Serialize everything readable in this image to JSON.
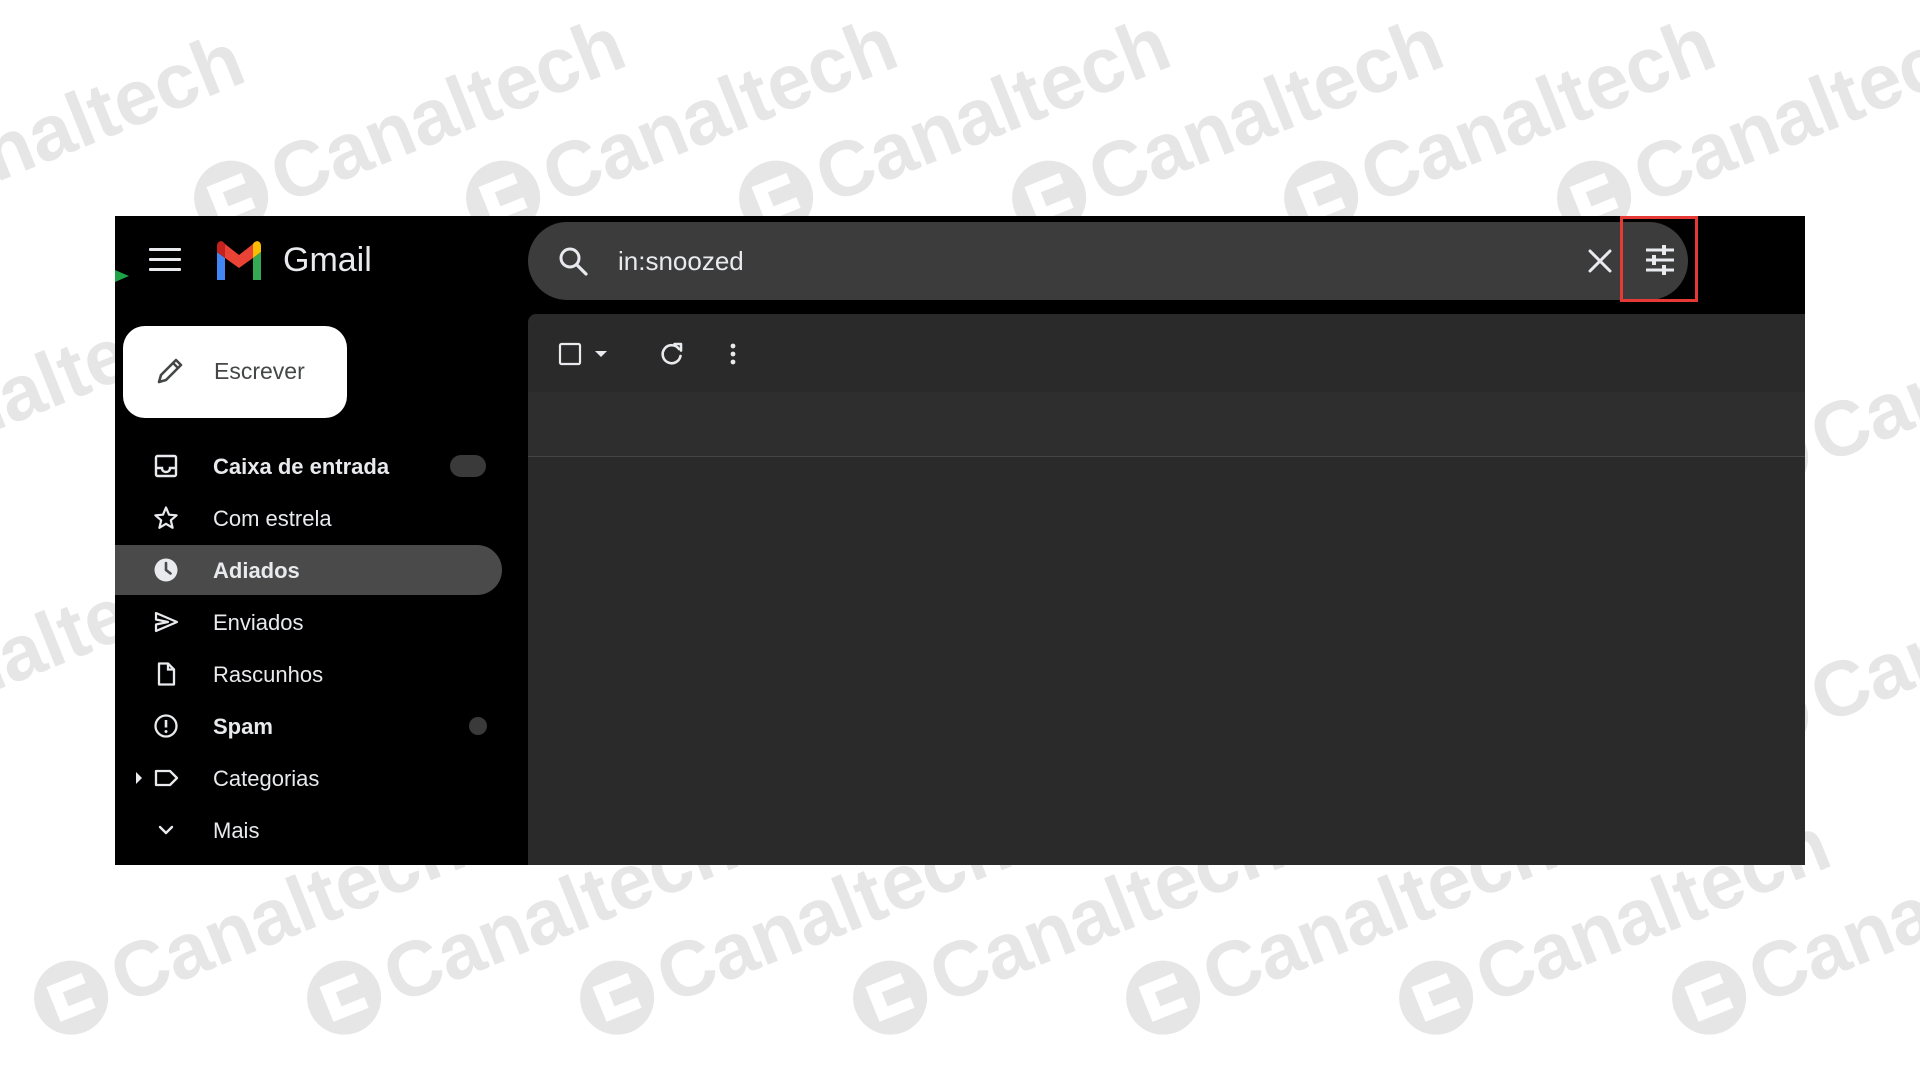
{
  "watermark": {
    "text": "Canaltech",
    "color": "#e6e6e6"
  },
  "header": {
    "app_name": "Gmail",
    "menu_icon": "hamburger-menu-icon",
    "logo_icon": "gmail-m-logo"
  },
  "search": {
    "value": "in:snoozed",
    "search_icon": "search-icon",
    "clear_icon": "close-icon",
    "options_icon": "tune-sliders-icon",
    "highlight_color": "#e53935"
  },
  "compose": {
    "label": "Escrever",
    "icon": "pencil-icon"
  },
  "sidebar": {
    "items": [
      {
        "label": "Caixa de entrada",
        "icon": "inbox-icon",
        "bold": true,
        "active": false
      },
      {
        "label": "Com estrela",
        "icon": "star-icon",
        "bold": false,
        "active": false
      },
      {
        "label": "Adiados",
        "icon": "clock-icon",
        "bold": true,
        "active": true
      },
      {
        "label": "Enviados",
        "icon": "send-icon",
        "bold": false,
        "active": false
      },
      {
        "label": "Rascunhos",
        "icon": "draft-file-icon",
        "bold": false,
        "active": false
      },
      {
        "label": "Spam",
        "icon": "spam-icon",
        "bold": true,
        "active": false
      },
      {
        "label": "Categorias",
        "icon": "label-icon",
        "bold": false,
        "active": false
      },
      {
        "label": "Mais",
        "icon": "chevron-down-icon",
        "bold": false,
        "active": false
      }
    ]
  },
  "toolbar": {
    "select_icon": "checkbox-icon",
    "select_dropdown_icon": "caret-down-icon",
    "refresh_icon": "refresh-icon",
    "more_icon": "more-vertical-icon"
  },
  "colors": {
    "background": "#000000",
    "main_panel": "#2a2a2a",
    "search_bar": "#3c3c3c",
    "active_item": "#4a4a4a",
    "text": "#e8eaed"
  }
}
